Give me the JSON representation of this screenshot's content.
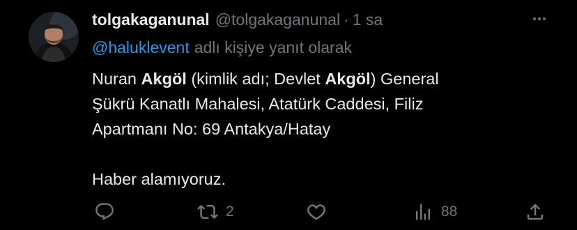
{
  "tweet": {
    "display_name": "tolgakaganunal",
    "handle": "@tolgakaganunal",
    "separator": "·",
    "time": "1 sa",
    "reply_mention": "@haluklevent",
    "reply_suffix": "adlı kişiye yanıt olarak",
    "body": {
      "line1_part1": "Nuran ",
      "line1_bold1": "Akgöl",
      "line1_part2": " (kimlik adı; Devlet ",
      "line1_bold2": "Akgöl",
      "line1_part3": ") General",
      "line2": "Şükrü Kanatlı Mahalesi, Atatürk Caddesi, Filiz",
      "line3": "Apartmanı No: 69 Antakya/Hatay",
      "line4": "Haber alamıyoruz."
    }
  },
  "actions": {
    "reply_icon": "reply-icon",
    "retweet_icon": "retweet-icon",
    "retweet_count": "2",
    "like_icon": "like-icon",
    "views_icon": "views-icon",
    "views_count": "88",
    "share_icon": "share-icon"
  },
  "colors": {
    "background": "#000000",
    "text_primary": "#e7e9ea",
    "text_secondary": "#71767b",
    "link": "#1d9bf0"
  }
}
